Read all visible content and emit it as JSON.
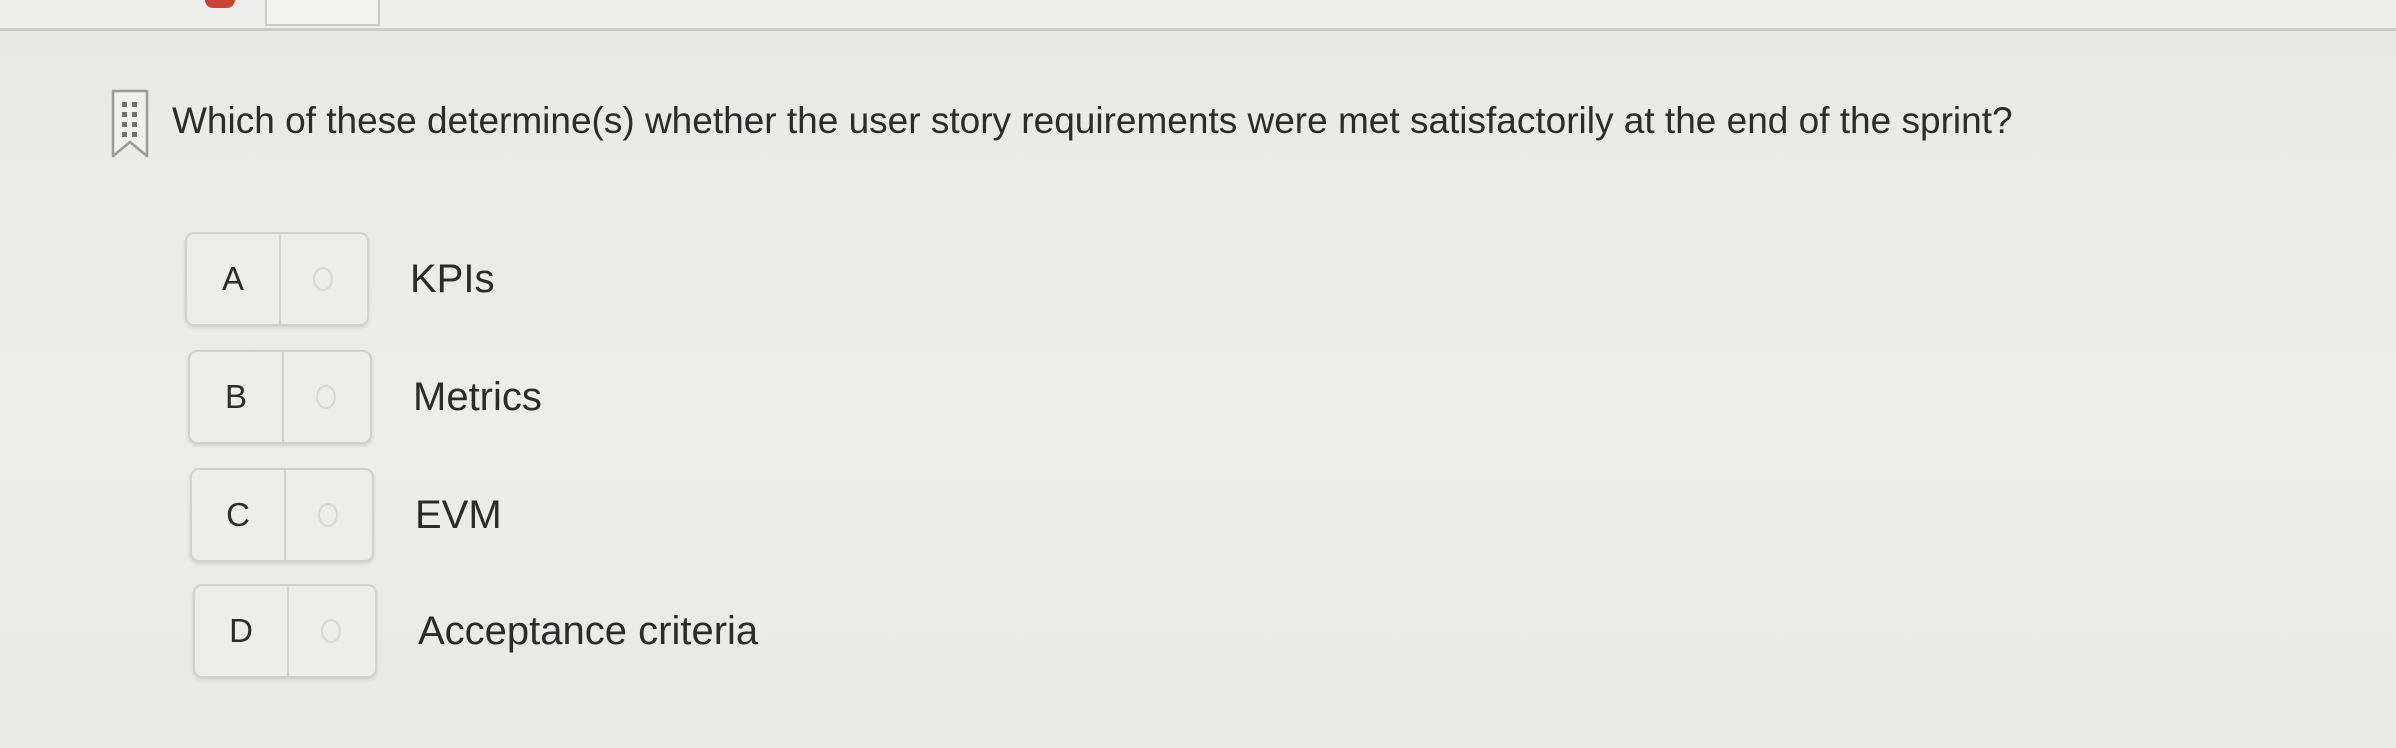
{
  "question": {
    "text": "Which of these determine(s) whether the user story requirements were met satisfactorily at the end of the sprint?"
  },
  "choices": [
    {
      "letter": "A",
      "text": "KPIs"
    },
    {
      "letter": "B",
      "text": "Metrics"
    },
    {
      "letter": "C",
      "text": "EVM"
    },
    {
      "letter": "D",
      "text": "Acceptance criteria"
    }
  ],
  "icons": {
    "flag": "bookmark-flag-icon",
    "radio": "radio-unselected-icon"
  },
  "colors": {
    "background": "#e9e9e7",
    "text": "#2b2b2b",
    "border": "#d0d0ce",
    "flag": "#9a9a98"
  }
}
